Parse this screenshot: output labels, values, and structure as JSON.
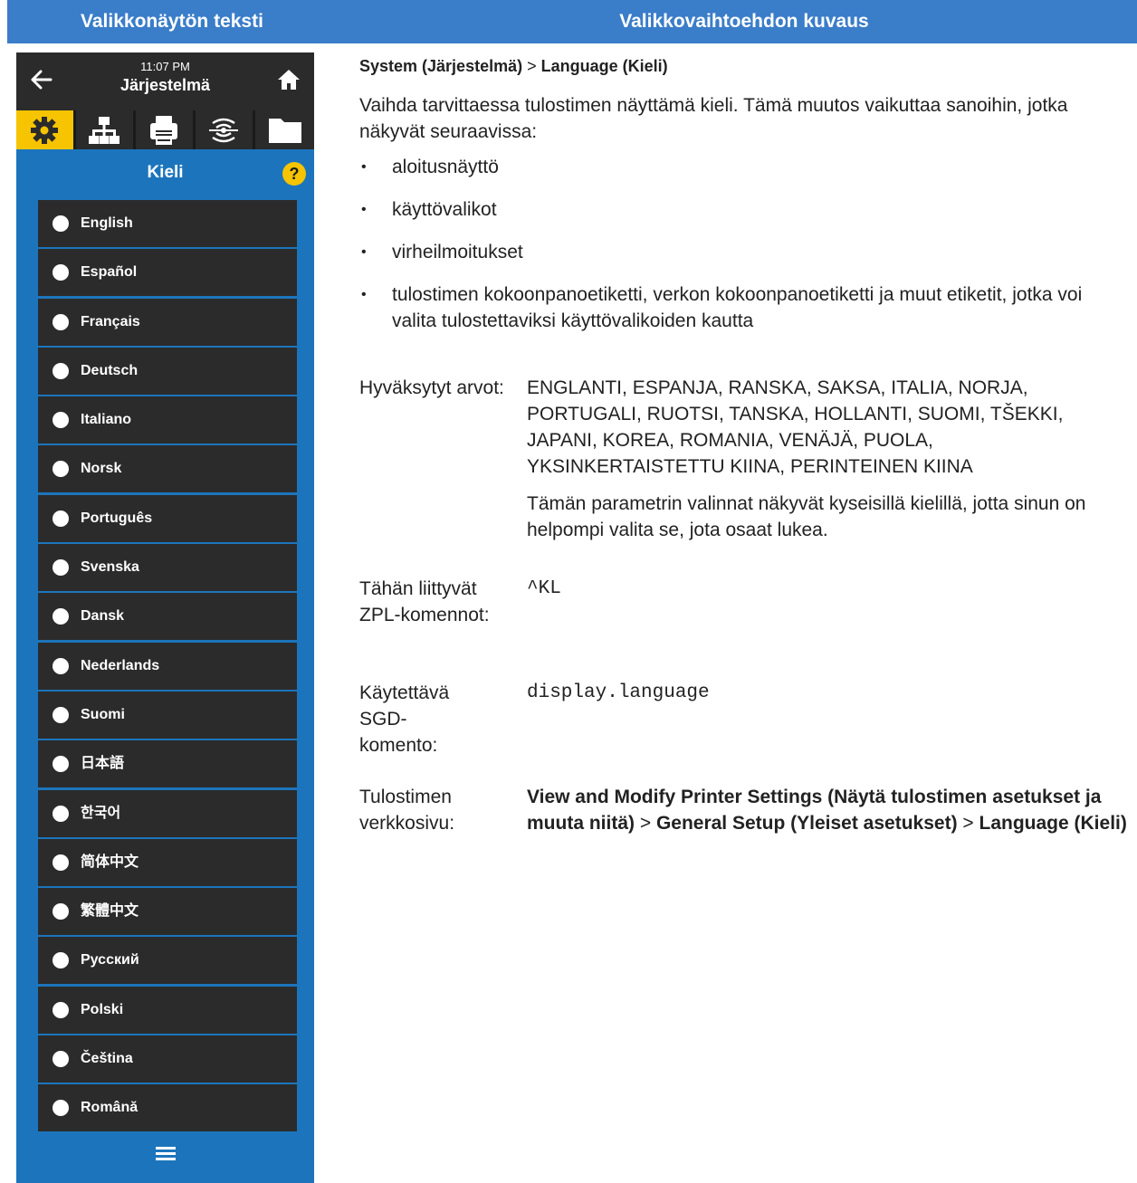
{
  "header": {
    "col1": "Valikkonäytön teksti",
    "col2": "Valikkovaihtoehdon kuvaus"
  },
  "screen": {
    "time": "11:07 PM",
    "title": "Järjestelmä",
    "section_title": "Kieli",
    "tabs": [
      "settings-gear-icon",
      "network-icon",
      "printer-icon",
      "wireless-signal-icon",
      "folder-icon"
    ],
    "languages": [
      "English",
      "Español",
      "Français",
      "Deutsch",
      "Italiano",
      "Norsk",
      "Português",
      "Svenska",
      "Dansk",
      "Nederlands",
      "Suomi",
      "日本語",
      "한국어",
      "简体中文",
      "繁體中文",
      "Русский",
      "Polski",
      "Čeština",
      "Română"
    ],
    "colors": {
      "accent_blue": "#1c75bc",
      "active_tab": "#f6c400",
      "dark": "#2b2b2b",
      "header_blue": "#3a7dc9"
    }
  },
  "description": {
    "path_1": "System (Järjestelmä)",
    "path_sep": " > ",
    "path_2": "Language (Kieli)",
    "intro": "Vaihda tarvittaessa tulostimen näyttämä kieli. Tämä muutos vaikuttaa sanoihin, jotka näkyvät seuraavissa:",
    "bullets": [
      "aloitusnäyttö",
      "käyttövalikot",
      "virheilmoitukset",
      "tulostimen kokoonpanoetiketti, verkon kokoonpanoetiketti ja muut etiketit, jotka voi valita tulostettaviksi käyttövalikoiden kautta"
    ],
    "accepted_label": "Hyväksytyt arvot:",
    "accepted_values": "ENGLANTI, ESPANJA, RANSKA, SAKSA, ITALIA, NORJA, PORTUGALI, RUOTSI, TANSKA, HOLLANTI, SUOMI, TŠEKKI, JAPANI, KOREA, ROMANIA, VENÄJÄ, PUOLA, YKSINKERTAISTETTU KIINA, PERINTEINEN KIINA",
    "accepted_note": "Tämän parametrin valinnat näkyvät kyseisillä kielillä, jotta sinun on helpompi valita se, jota osaat lukea.",
    "zpl_label": "Tähän liittyvät ZPL-komennot:",
    "zpl_value": "^KL",
    "sgd_label": "Käytettävä SGD-komento:",
    "sgd_value": "display.language",
    "web_label": "Tulostimen verkkosivu:",
    "web_1": "View and Modify Printer Settings (Näytä tulostimen asetukset ja muuta niitä)",
    "web_sep_1": " > ",
    "web_2": "General Setup (Yleiset asetukset)",
    "web_sep_2": " > ",
    "web_3": "Language (Kieli)"
  }
}
